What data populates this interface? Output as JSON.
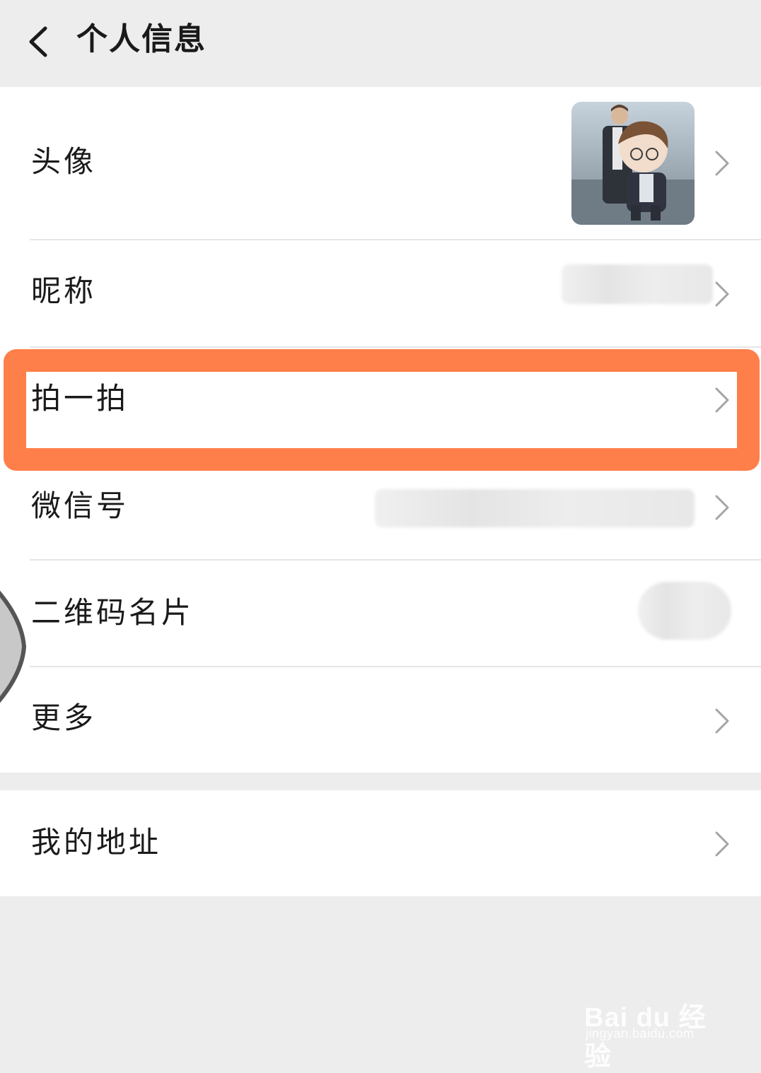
{
  "header": {
    "title": "个人信息",
    "back_icon": "chevron-left-icon"
  },
  "profile": {
    "avatar_label": "头像",
    "nickname_label": "昵称",
    "pat_label": "拍一拍",
    "wechat_id_label": "微信号",
    "qrcode_label": "二维码名片",
    "more_label": "更多"
  },
  "address": {
    "label": "我的地址"
  },
  "highlight_color": "#ff7f4a",
  "watermark": {
    "main": "Bai du 经验",
    "sub": "jingyan.baidu.com"
  }
}
